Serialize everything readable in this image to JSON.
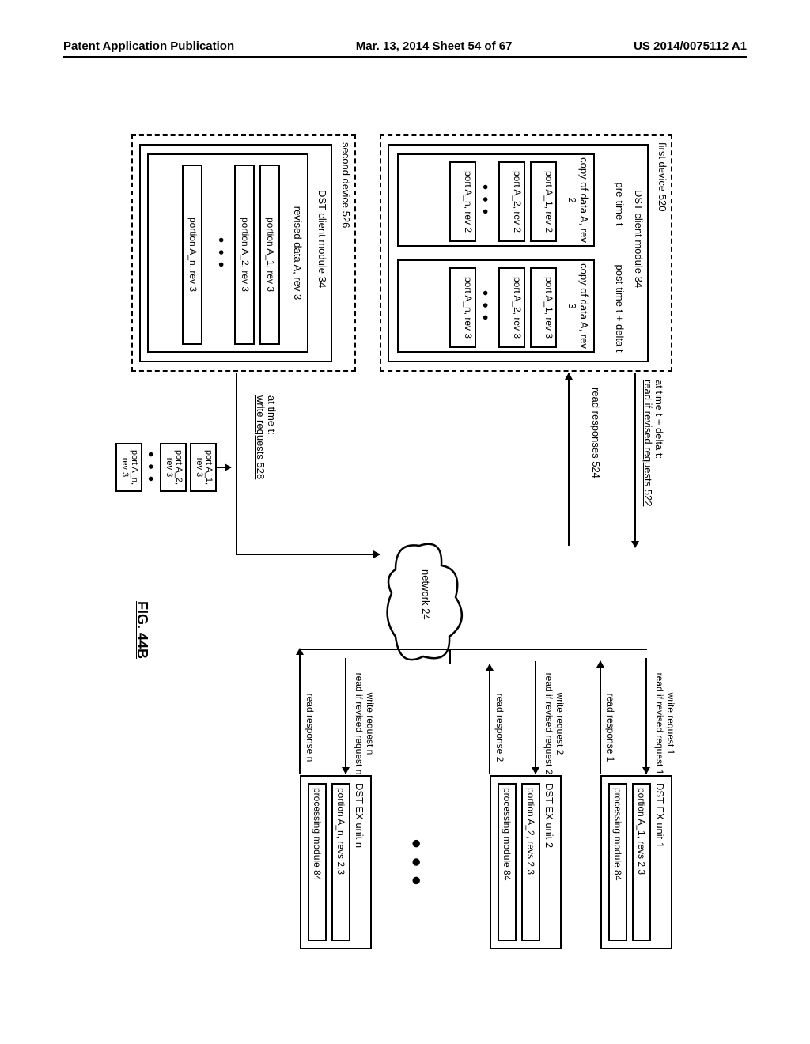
{
  "header": {
    "left": "Patent Application Publication",
    "mid": "Mar. 13, 2014  Sheet 54 of 67",
    "right": "US 2014/0075112 A1"
  },
  "first_device": {
    "title": "first device 520",
    "module": "DST client module 34",
    "pre_t": "pre-time t",
    "post_t": "post-time t + delta t",
    "copy_pre": {
      "title": "copy of data A, rev 2",
      "p1": "port A_1, rev 2",
      "p2": "port A_2, rev 2",
      "pn": "port A_n, rev 2"
    },
    "copy_post": {
      "title": "copy of data A, rev 3",
      "p1": "port A_1, rev 3",
      "p2": "port A_2, rev 3",
      "pn": "port A_n, rev 3"
    }
  },
  "labels": {
    "at_delta": "at time t + delta t:",
    "read_if": "read if revised requests 522",
    "read_resp": "read responses 524",
    "at_t": "at time t:",
    "write_req": "write requests 528",
    "net": "network 24"
  },
  "second_device": {
    "title": "second device 526",
    "module": "DST client module 34",
    "rev3": {
      "title": "revised data A, rev 3",
      "r1": "portion A_1, rev 3",
      "r2": "portion A_2, rev 3",
      "rn": "portion A_n, rev 3"
    }
  },
  "ports": {
    "p1": "port A_1, rev 3",
    "p2": "port A_2, rev 3",
    "pn": "port A_n, rev 3"
  },
  "arrows": {
    "w1": "write request 1",
    "r1": "read if revised request 1",
    "rr1": "read response 1",
    "w2": "write request 2",
    "r2": "read if revised request 2",
    "rr2": "read response 2",
    "wn": "write request n",
    "rn_": "read if revised request n",
    "rrn": "read response n"
  },
  "units": {
    "u1": {
      "t": "DST EX unit 1",
      "p": "portion A_1, revs 2,3",
      "m": "processing module 84"
    },
    "u2": {
      "t": "DST EX unit 2",
      "p": "portion A_2, revs 2,3",
      "m": "processing module 84"
    },
    "un": {
      "t": "DST EX unit n",
      "p": "portion A_n, revs 2,3",
      "m": "processing module 84"
    }
  },
  "fig": "FIG. 44B",
  "dots": "● ● ●"
}
